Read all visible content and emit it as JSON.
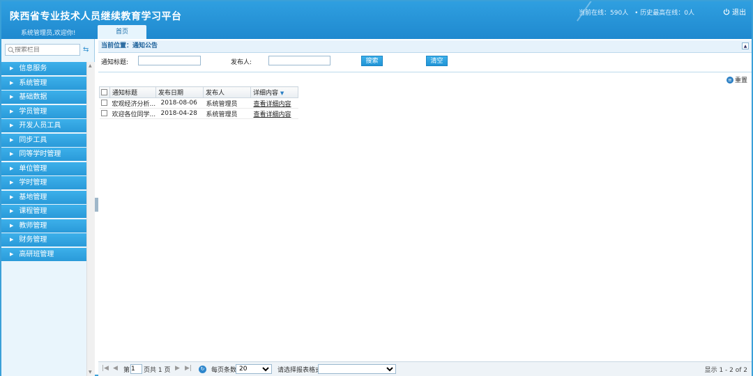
{
  "header": {
    "title": "陕西省专业技术人员继续教育学习平台",
    "welcome": "系统管理员,欢迎你!",
    "online_now": "当前在线：590人",
    "online_peak": "• 历史最高在线：0人",
    "logout_label": "退出",
    "home_tab": "首页"
  },
  "sidebar": {
    "search_placeholder": "搜索栏目",
    "items": [
      {
        "label": "信息服务"
      },
      {
        "label": "系统管理"
      },
      {
        "label": "基础数据"
      },
      {
        "label": "学员管理"
      },
      {
        "label": "开发人员工具"
      },
      {
        "label": "同步工具"
      },
      {
        "label": "同等学时管理"
      },
      {
        "label": "单位管理"
      },
      {
        "label": "学时管理"
      },
      {
        "label": "基地管理"
      },
      {
        "label": "课程管理"
      },
      {
        "label": "教师管理"
      },
      {
        "label": "财务管理"
      },
      {
        "label": "高研班管理"
      }
    ]
  },
  "main": {
    "location": "当前位置：通知公告",
    "filter": {
      "title_label": "通知标题:",
      "publisher_label": "发布人:",
      "search_button": "搜索",
      "clear_button": "清空"
    },
    "reset_label": "重置",
    "columns": [
      "通知标题",
      "发布日期",
      "发布人",
      "详细内容"
    ],
    "rows": [
      {
        "title": "宏观经济分析...",
        "date": "2018-08-06",
        "publisher": "系统管理员",
        "detail": "查看详细内容"
      },
      {
        "title": "欢迎各位同学...",
        "date": "2018-04-28",
        "publisher": "系统管理员",
        "detail": "查看详细内容"
      }
    ],
    "pager": {
      "page_prefix": "第",
      "page_value": "1",
      "page_suffix": "页共 1 页",
      "per_page_label": "每页条数",
      "per_page_value": "20",
      "export_label": "请选择报表格式",
      "display_info": "显示 1 - 2 of 2"
    }
  }
}
